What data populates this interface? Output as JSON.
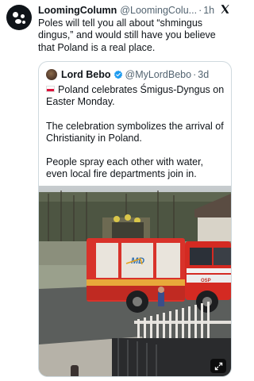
{
  "tweet": {
    "author_name": "LoomingColumn",
    "author_handle": "@LoomingColu...",
    "separator": "·",
    "time": "1h",
    "text": "Poles will tell you all about “shmingus dingus,” and would still have you believe that Poland is a real place."
  },
  "quoted_tweet": {
    "author_name": "Lord Bebo",
    "author_handle": "@MyLordBebo",
    "separator": "·",
    "time": "3d",
    "paragraphs": [
      "Poland celebrates Śmigus-Dyngus on Easter Monday.",
      "The celebration symbolizes the arrival of Christianity in Poland.",
      "People spray each other with water, even local fire departments join in."
    ],
    "flag_icon": "poland-flag-icon"
  },
  "icons": {
    "brand": "x-logo-icon",
    "verified": "verified-badge-icon",
    "media_action": "expand-icon"
  },
  "colors": {
    "text": "#0f1419",
    "secondary": "#536471",
    "verified_blue": "#1d9bf0",
    "border": "#cfd9de"
  }
}
